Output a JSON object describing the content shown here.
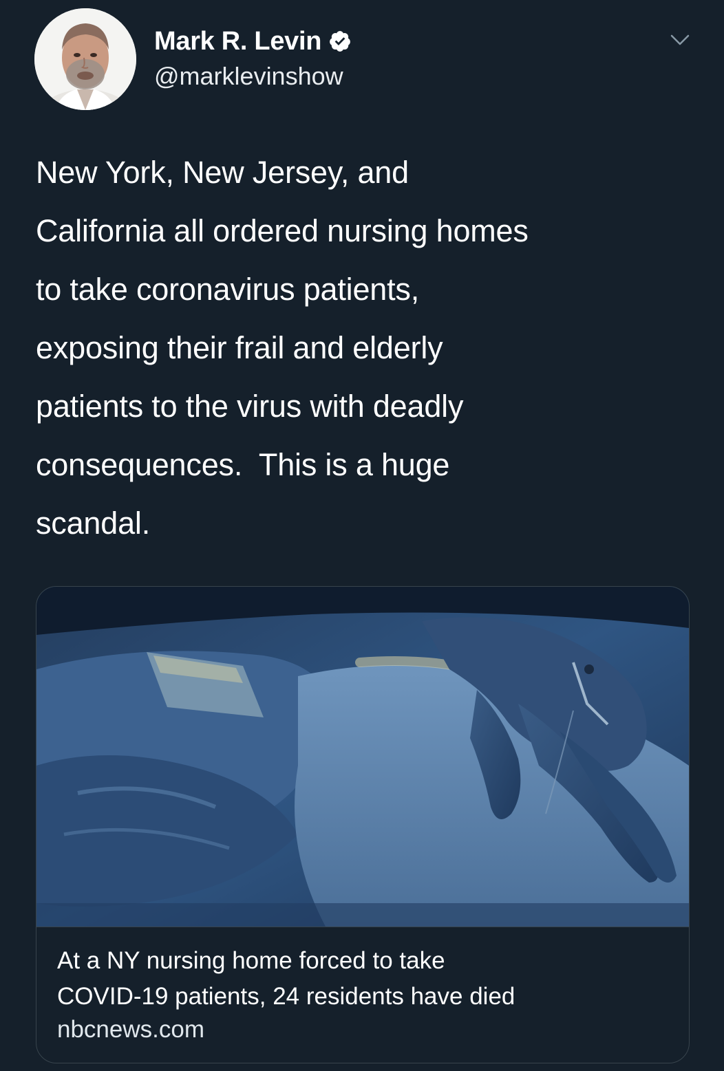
{
  "author": {
    "display_name": "Mark R. Levin",
    "handle": "@marklevinshow",
    "verified_icon": "verified-badge-icon",
    "avatar": "profile-photo"
  },
  "tweet": {
    "text": "New York, New Jersey, and\nCalifornia all ordered nursing homes\nto take coronavirus patients,\nexposing their frail and elderly\npatients to the virus with deadly\nconsequences.  This is a huge\nscandal."
  },
  "menu": {
    "icon": "chevron-down-icon"
  },
  "link_card": {
    "image": "hospital-bed-hand-photo",
    "title": "At a NY nursing home forced to take\nCOVID-19 patients, 24 residents have died",
    "domain": "nbcnews.com"
  },
  "colors": {
    "background": "#15202b",
    "border": "#38444d",
    "text": "#ffffff",
    "verified_badge": "#ffffff"
  }
}
